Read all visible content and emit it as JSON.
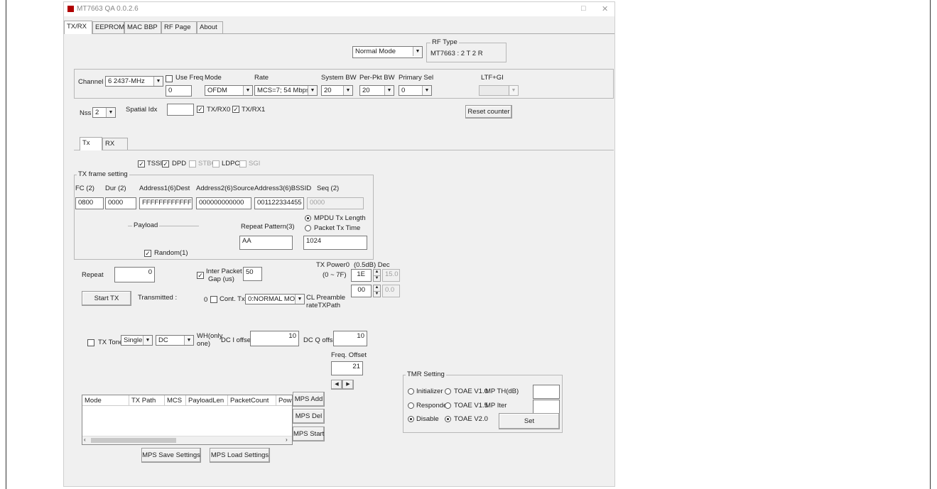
{
  "window": {
    "title": "MT7663 QA 0.0.2.6",
    "minimize": "□",
    "close": "✕"
  },
  "tabs": [
    "TX/RX",
    "EEPROM",
    "MAC BBP",
    "RF Page",
    "About"
  ],
  "mode_select": "Normal Mode",
  "rf_type": {
    "label": "RF Type",
    "value": "MT7663 : 2 T 2 R"
  },
  "channel": {
    "channel_label": "Channel",
    "channel_value": "6 2437-MHz",
    "use_freq_label": "Use Freq",
    "use_freq_value": "0",
    "mode_label": "Mode",
    "mode_value": "OFDM",
    "rate_label": "Rate",
    "rate_value": "MCS=7; 54 Mbps",
    "system_bw_label": "System BW",
    "system_bw_value": "20",
    "per_pkt_bw_label": "Per-Pkt BW",
    "per_pkt_bw_value": "20",
    "primary_sel_label": "Primary Sel",
    "primary_sel_value": "0",
    "ltf_gi_label": "LTF+GI",
    "ltf_gi_value": ""
  },
  "nss": {
    "label": "Nss",
    "value": "2",
    "spatial_idx_label": "Spatial Idx",
    "spatial_idx_value": "",
    "txrx0_label": "TX/RX0",
    "txrx1_label": "TX/RX1",
    "reset_counter": "Reset counter"
  },
  "inner_tabs": [
    "Tx",
    "RX"
  ],
  "options": {
    "tssi": "TSSI",
    "dpd": "DPD",
    "stbc": "STBC",
    "ldpc": "LDPC",
    "sgi": "SGI"
  },
  "tx_frame": {
    "group_label": "TX frame setting",
    "fc_label": "FC (2)",
    "dur_label": "Dur (2)",
    "addr1_label": "Address1(6)Dest",
    "addr2_label": "Address2(6)Source",
    "addr3_label": "Address3(6)BSSID",
    "seq_label": "Seq (2)",
    "fc_value": "0800",
    "dur_value": "0000",
    "addr1_value": "FFFFFFFFFFFF",
    "addr2_value": "000000000000",
    "addr3_value": "001122334455",
    "seq_value": "0000",
    "payload_label": "Payload",
    "random_label": "Random(1)",
    "repeat_pattern_label": "Repeat Pattern(3)",
    "repeat_pattern_value": "AA",
    "mpdu_label": "MPDU Tx Length",
    "packet_tx_time_label": "Packet Tx Time",
    "length_value": "1024"
  },
  "tx_controls": {
    "repeat_label": "Repeat",
    "repeat_value": "0",
    "inter_packet_gap_label_1": "Inter Packet",
    "inter_packet_gap_label_2": "Gap (us)",
    "inter_packet_gap_value": "50",
    "start_tx": "Start TX",
    "transmitted_label": "Transmitted :",
    "transmitted_value": "0",
    "cont_tx_label": "Cont. Tx",
    "cont_tx_value": "0:NORMAL MOD",
    "tx_power_label_1": "TX Power0",
    "tx_power_label_2": "(0.5dB) Dec",
    "tx_power_range": "(0 ~ 7F)",
    "tx_power_value": "1E",
    "tx_power_dec": "15.0",
    "power2_value": "00",
    "power2_dec": "0.0",
    "cl_preamble_1": "CL Preamble",
    "cl_preamble_2": "rateTXPath"
  },
  "tone": {
    "tx_tone_label": "TX Tone",
    "tone_type": "Single",
    "tone_dc": "DC",
    "wh_only_1": "WH(only",
    "wh_only_2": "one)",
    "dc_i_label": "DC I offset",
    "dc_i_value": "10",
    "dc_q_label": "DC Q offset",
    "dc_q_value": "10",
    "freq_offset_label": "Freq. Offset",
    "freq_offset_value": "21"
  },
  "tmr": {
    "group_label": "TMR Setting",
    "initializer": "Initializer",
    "responder": "Responder",
    "disable": "Disable",
    "toae_v10": "TOAE V1.0",
    "toae_v15": "TOAE V1.5",
    "toae_v20": "TOAE V2.0",
    "mp_th_label": "MP TH(dB)",
    "mp_iter_label": "MP Iter",
    "set": "Set"
  },
  "mps": {
    "columns": [
      "Mode",
      "TX Path",
      "MCS",
      "PayloadLen",
      "PacketCount",
      "Pow"
    ],
    "add": "MPS Add",
    "del": "MPS Del",
    "start": "MPS Start",
    "save": "MPS Save Settings",
    "load": "MPS Load Settings"
  }
}
